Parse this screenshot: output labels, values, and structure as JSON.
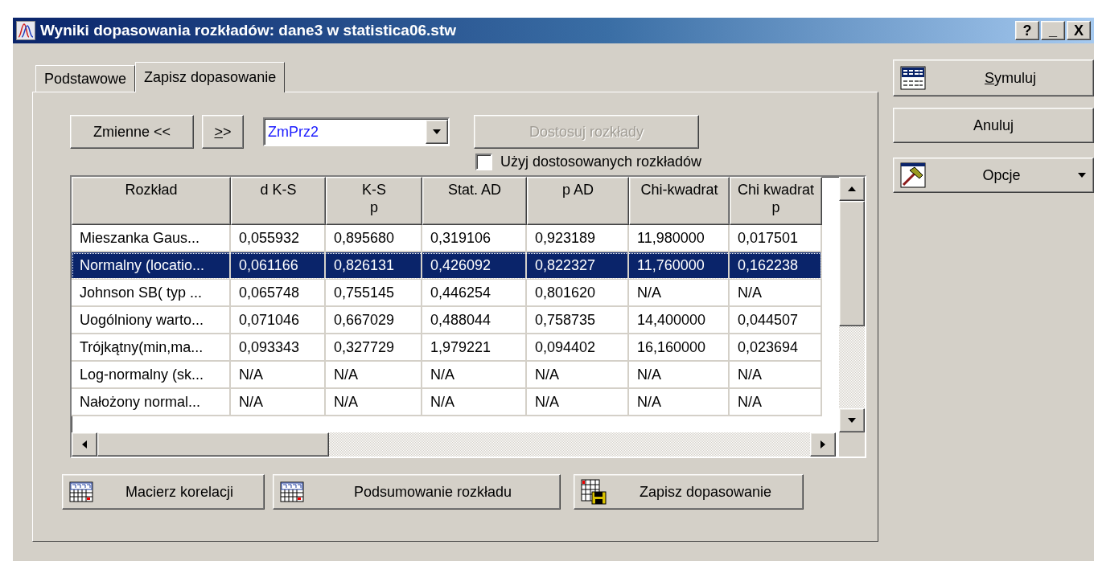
{
  "window": {
    "title": "Wyniki dopasowania rozkładów: dane3 w statistica06.stw",
    "controls": [
      "?",
      "_",
      "X"
    ]
  },
  "tabs": [
    {
      "label": "Podstawowe",
      "selected": false
    },
    {
      "label": "Zapisz dopasowanie",
      "selected": true
    }
  ],
  "toolbar": {
    "variables_button": "Zmienne <<",
    "next_button": {
      "label": ">>",
      "underline_first": true
    },
    "variable_select": {
      "value": "ZmPrz2"
    },
    "fit_button": {
      "label": "Dostosuj rozkłady",
      "disabled": true
    }
  },
  "use_fitted": {
    "label": "Użyj dostosowanych rozkładów",
    "checked": false
  },
  "table": {
    "columns": [
      "Rozkład",
      "d K-S",
      "K-S\np",
      "Stat. AD",
      "p AD",
      "Chi-kwadrat",
      "Chi kwadrat\np"
    ],
    "rows": [
      {
        "selected": false,
        "cells": [
          "Mieszanka Gaus...",
          "0,055932",
          "0,895680",
          "0,319106",
          "0,923189",
          "11,980000",
          "0,017501"
        ]
      },
      {
        "selected": true,
        "cells": [
          "Normalny (locatio...",
          "0,061166",
          "0,826131",
          "0,426092",
          "0,822327",
          "11,760000",
          "0,162238"
        ]
      },
      {
        "selected": false,
        "cells": [
          "Johnson SB( typ ...",
          "0,065748",
          "0,755145",
          "0,446254",
          "0,801620",
          "N/A",
          "N/A"
        ]
      },
      {
        "selected": false,
        "cells": [
          "Uogólniony warto...",
          "0,071046",
          "0,667029",
          "0,488044",
          "0,758735",
          "14,400000",
          "0,044507"
        ]
      },
      {
        "selected": false,
        "cells": [
          "Trójkątny(min,ma...",
          "0,093343",
          "0,327729",
          "1,979221",
          "0,094402",
          "16,160000",
          "0,023694"
        ]
      },
      {
        "selected": false,
        "cells": [
          "Log-normalny (sk...",
          "N/A",
          "N/A",
          "N/A",
          "N/A",
          "N/A",
          "N/A"
        ]
      },
      {
        "selected": false,
        "cells": [
          "Nałożony normal...",
          "N/A",
          "N/A",
          "N/A",
          "N/A",
          "N/A",
          "N/A"
        ]
      }
    ]
  },
  "bottom_buttons": [
    {
      "label": "Macierz korelacji",
      "kind": "summary"
    },
    {
      "label": "Podsumowanie rozkładu",
      "kind": "summary"
    },
    {
      "label": "Zapisz dopasowanie",
      "kind": "save"
    }
  ],
  "side_buttons": [
    {
      "label": "Symuluj",
      "kind": "table",
      "underline_first": true
    },
    {
      "label": "Anuluj",
      "kind": "plain",
      "underline_first": false
    },
    {
      "label": "Opcje",
      "kind": "menu",
      "underline_first": false
    }
  ]
}
